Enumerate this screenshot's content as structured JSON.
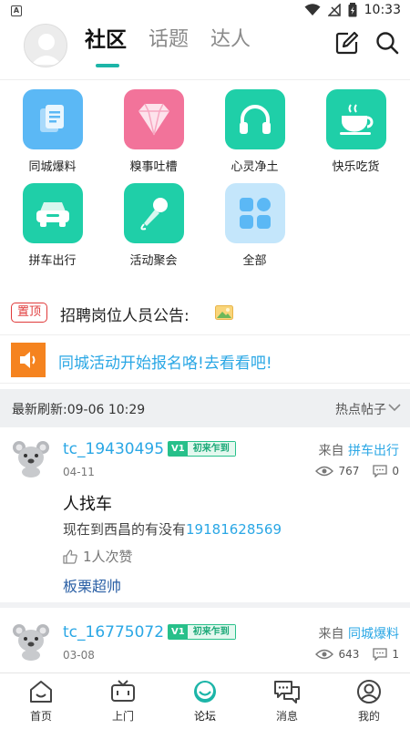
{
  "status_bar": {
    "time": "10:33"
  },
  "header": {
    "tabs": [
      {
        "label": "社区",
        "active": true
      },
      {
        "label": "话题",
        "active": false
      },
      {
        "label": "达人",
        "active": false
      }
    ],
    "accent": "#1cb5a8"
  },
  "categories": [
    {
      "label": "同城爆料",
      "icon": "document-icon",
      "color": "#5bb8f5"
    },
    {
      "label": "糗事吐槽",
      "icon": "diamond-icon",
      "color": "#f2739a"
    },
    {
      "label": "心灵净土",
      "icon": "headphones-icon",
      "color": "#1fcfa8"
    },
    {
      "label": "快乐吃货",
      "icon": "coffee-cup-icon",
      "color": "#1fcfa8"
    },
    {
      "label": "拼车出行",
      "icon": "car-icon",
      "color": "#1fcfa8"
    },
    {
      "label": "活动聚会",
      "icon": "microphone-icon",
      "color": "#1fcfa8"
    },
    {
      "label": "全部",
      "icon": "grid-icon",
      "color": "#c4e6fb"
    }
  ],
  "notice": {
    "badge": "置顶",
    "text": "招聘岗位人员公告:"
  },
  "banner": {
    "text": "同城活动开始报名咯!去看看吧!"
  },
  "refresh": {
    "label": "最新刷新:",
    "time": "09-06 10:29",
    "sort": "热点帖子"
  },
  "posts": [
    {
      "user": "tc_19430495",
      "level": "V1",
      "level_name": "初来乍到",
      "date": "04-11",
      "from_label": "来自",
      "category": "拼车出行",
      "views": "767",
      "comments": "0",
      "title": "人找车",
      "body": "现在到西昌的有没有",
      "phone": "19181628569",
      "likes": "1人次赞",
      "comment_text": "板栗超帅"
    },
    {
      "user": "tc_16775072",
      "level": "V1",
      "level_name": "初来乍到",
      "date": "03-08",
      "from_label": "来自",
      "category": "同城爆料",
      "views": "643",
      "comments": "1"
    }
  ],
  "bottom_nav": [
    {
      "label": "首页",
      "icon": "home-icon",
      "active": false
    },
    {
      "label": "上门",
      "icon": "tv-icon",
      "active": false
    },
    {
      "label": "论坛",
      "icon": "forum-icon",
      "active": true
    },
    {
      "label": "消息",
      "icon": "message-icon",
      "active": false
    },
    {
      "label": "我的",
      "icon": "profile-icon",
      "active": false
    }
  ]
}
